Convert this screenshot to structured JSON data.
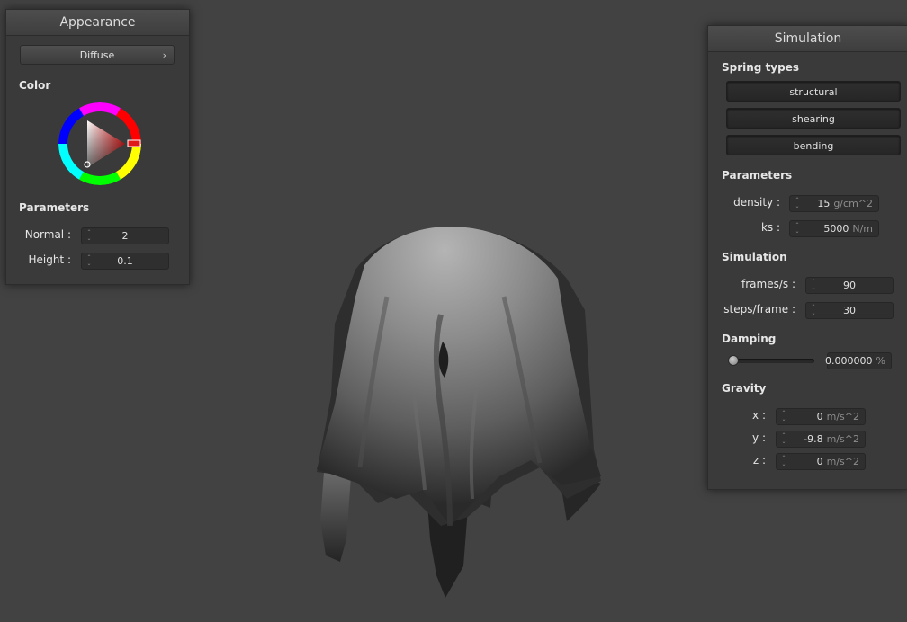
{
  "appearance": {
    "title": "Appearance",
    "shader_dropdown": {
      "value": "Diffuse"
    },
    "color_label": "Color",
    "color_icon": "color-wheel",
    "selected_color": "#e01818",
    "parameters_label": "Parameters",
    "normal": {
      "label": "Normal :",
      "value": "2"
    },
    "height": {
      "label": "Height :",
      "value": "0.1"
    }
  },
  "simulation": {
    "title": "Simulation",
    "spring_types_label": "Spring types",
    "spring_types": [
      "structural",
      "shearing",
      "bending"
    ],
    "parameters_label": "Parameters",
    "density": {
      "label": "density :",
      "value": "15",
      "unit": "g/cm^2"
    },
    "ks": {
      "label": "ks :",
      "value": "5000",
      "unit": "N/m"
    },
    "simulation_label": "Simulation",
    "frames_per_s": {
      "label": "frames/s :",
      "value": "90"
    },
    "steps_per_frame": {
      "label": "steps/frame :",
      "value": "30"
    },
    "damping_label": "Damping",
    "damping": {
      "value": "0.000000",
      "unit": "%",
      "fraction": 0
    },
    "gravity_label": "Gravity",
    "gravity": {
      "x": {
        "label": "x :",
        "value": "0",
        "unit": "m/s^2"
      },
      "y": {
        "label": "y :",
        "value": "-9.8",
        "unit": "m/s^2"
      },
      "z": {
        "label": "z :",
        "value": "0",
        "unit": "m/s^2"
      }
    }
  },
  "scene": {
    "object": "cloth draped over sphere"
  }
}
